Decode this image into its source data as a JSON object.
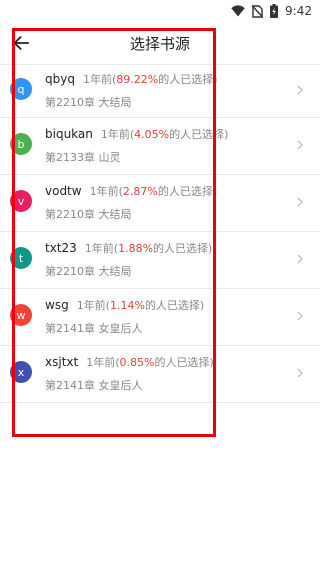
{
  "status_bar": {
    "time": "9:42",
    "icons": [
      "wifi-icon",
      "no-sim-icon",
      "battery-icon"
    ]
  },
  "toolbar": {
    "title": "选择书源",
    "back_icon": "arrow-left-icon"
  },
  "sources": [
    {
      "avatar": "q",
      "color": "#2f95f3",
      "name": "qbyq",
      "time_ago": "1年前(",
      "percent": "89.22%",
      "suffix": "的人已选择)",
      "chapter": "第2210章 大结局"
    },
    {
      "avatar": "b",
      "color": "#4caf50",
      "name": "biqukan",
      "time_ago": "1年前(",
      "percent": "4.05%",
      "suffix": "的人已选择)",
      "chapter": "第2133章 山灵"
    },
    {
      "avatar": "v",
      "color": "#e91e63",
      "name": "vodtw",
      "time_ago": "1年前(",
      "percent": "2.87%",
      "suffix": "的人已选择)",
      "chapter": "第2210章 大结局"
    },
    {
      "avatar": "t",
      "color": "#0f9688",
      "name": "txt23",
      "time_ago": "1年前(",
      "percent": "1.88%",
      "suffix": "的人已选择)",
      "chapter": "第2210章 大结局"
    },
    {
      "avatar": "w",
      "color": "#f44336",
      "name": "wsg",
      "time_ago": "1年前(",
      "percent": "1.14%",
      "suffix": "的人已选择)",
      "chapter": "第2141章 女皇后人"
    },
    {
      "avatar": "x",
      "color": "#3f51b5",
      "name": "xsjtxt",
      "time_ago": "1年前(",
      "percent": "0.85%",
      "suffix": "的人已选择)",
      "chapter": "第2141章 女皇后人"
    }
  ],
  "highlight_color": "#e8000b"
}
